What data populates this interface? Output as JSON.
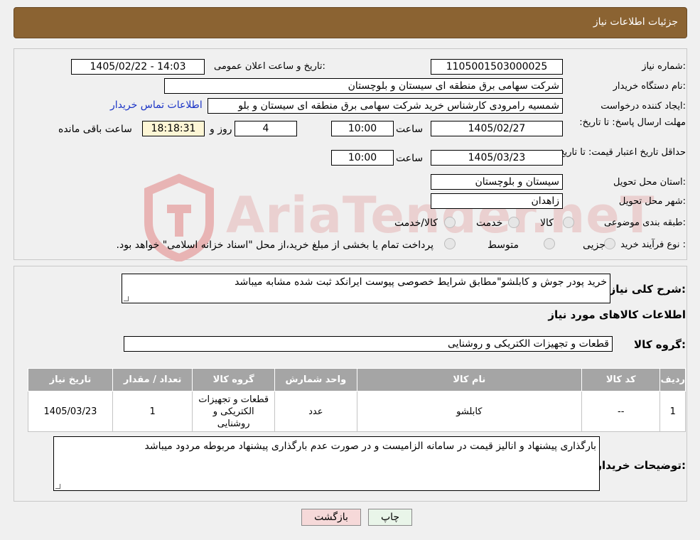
{
  "header": {
    "title": "جزئیات اطلاعات نیاز"
  },
  "fields": {
    "need_number_label": "شماره نیاز:",
    "need_number": "1105001503000025",
    "announce_label": "تاریخ و ساعت اعلان عمومی:",
    "announce_value": "1405/02/22 - 14:03",
    "buyer_org_label": "نام دستگاه خریدار:",
    "buyer_org": "شرکت سهامی برق منطقه ای سیستان و بلوچستان",
    "creator_label": "ایجاد کننده درخواست:",
    "creator": "شمسیه رامرودی کارشناس خرید شرکت سهامی برق منطقه ای سیستان و بلو",
    "contact_link": "اطلاعات تماس خریدار",
    "deadline_label": "مهلت ارسال پاسخ: تا تاریخ:",
    "deadline_date": "1405/02/27",
    "time_label": "ساعت",
    "deadline_time": "10:00",
    "days_value": "4",
    "days_label": "روز و",
    "remaining_time": "18:18:31",
    "remaining_label": "ساعت باقی مانده",
    "validity_label": "حداقل تاریخ اعتبار قیمت: تا تاریخ:",
    "validity_date": "1405/03/23",
    "validity_time": "10:00",
    "province_label": "استان محل تحویل:",
    "province": "سیستان و بلوچستان",
    "city_label": "شهر محل تحویل:",
    "city": "زاهدان",
    "category_label": "طبقه بندی موضوعی:",
    "category_options": [
      "کالا",
      "خدمت",
      "کالا/خدمت"
    ],
    "process_label": "نوع فرآیند خرید :",
    "process_options": [
      "جزیی",
      "متوسط"
    ],
    "process_note": "پرداخت تمام یا بخشی از مبلغ خرید،از محل \"اسناد خزانه اسلامی\" خواهد بود."
  },
  "summary": {
    "label": "شرح کلی نیاز:",
    "text": "خرید پودر جوش و کابلشو\"مطابق شرایط خصوصی پیوست ایرانکد ثبت شده مشابه میباشد",
    "goods_info_title": "اطلاعات کالاهای مورد نیاز",
    "goods_group_label": "گروه کالا:",
    "goods_group": "قطعات و تجهیزات الکتریکی و روشنایی"
  },
  "table": {
    "headers": [
      "ردیف",
      "کد کالا",
      "نام کالا",
      "واحد شمارش",
      "گروه کالا",
      "تعداد / مقدار",
      "تاریخ نیاز"
    ],
    "rows": [
      [
        "1",
        "--",
        "کابلشو",
        "عدد",
        "قطعات و تجهیزات الکتریکی و روشنایی",
        "1",
        "1405/03/23"
      ]
    ]
  },
  "buyer_notes": {
    "label": "توضیحات خریدار:",
    "text": "بارگذاری پیشنهاد و انالیز قیمت در سامانه الزامیست و در صورت عدم بارگذاری پیشنهاد مربوطه مردود میباشد"
  },
  "buttons": {
    "print": "چاپ",
    "back": "بازگشت"
  },
  "watermark": {
    "text": "AriaTender.neT"
  },
  "colors": {
    "header_bg": "#8b6332",
    "table_header": "#a5a5a5",
    "link": "#1a33c6",
    "back_button": "#f6d9d9",
    "print_button": "#e9f5e9"
  }
}
